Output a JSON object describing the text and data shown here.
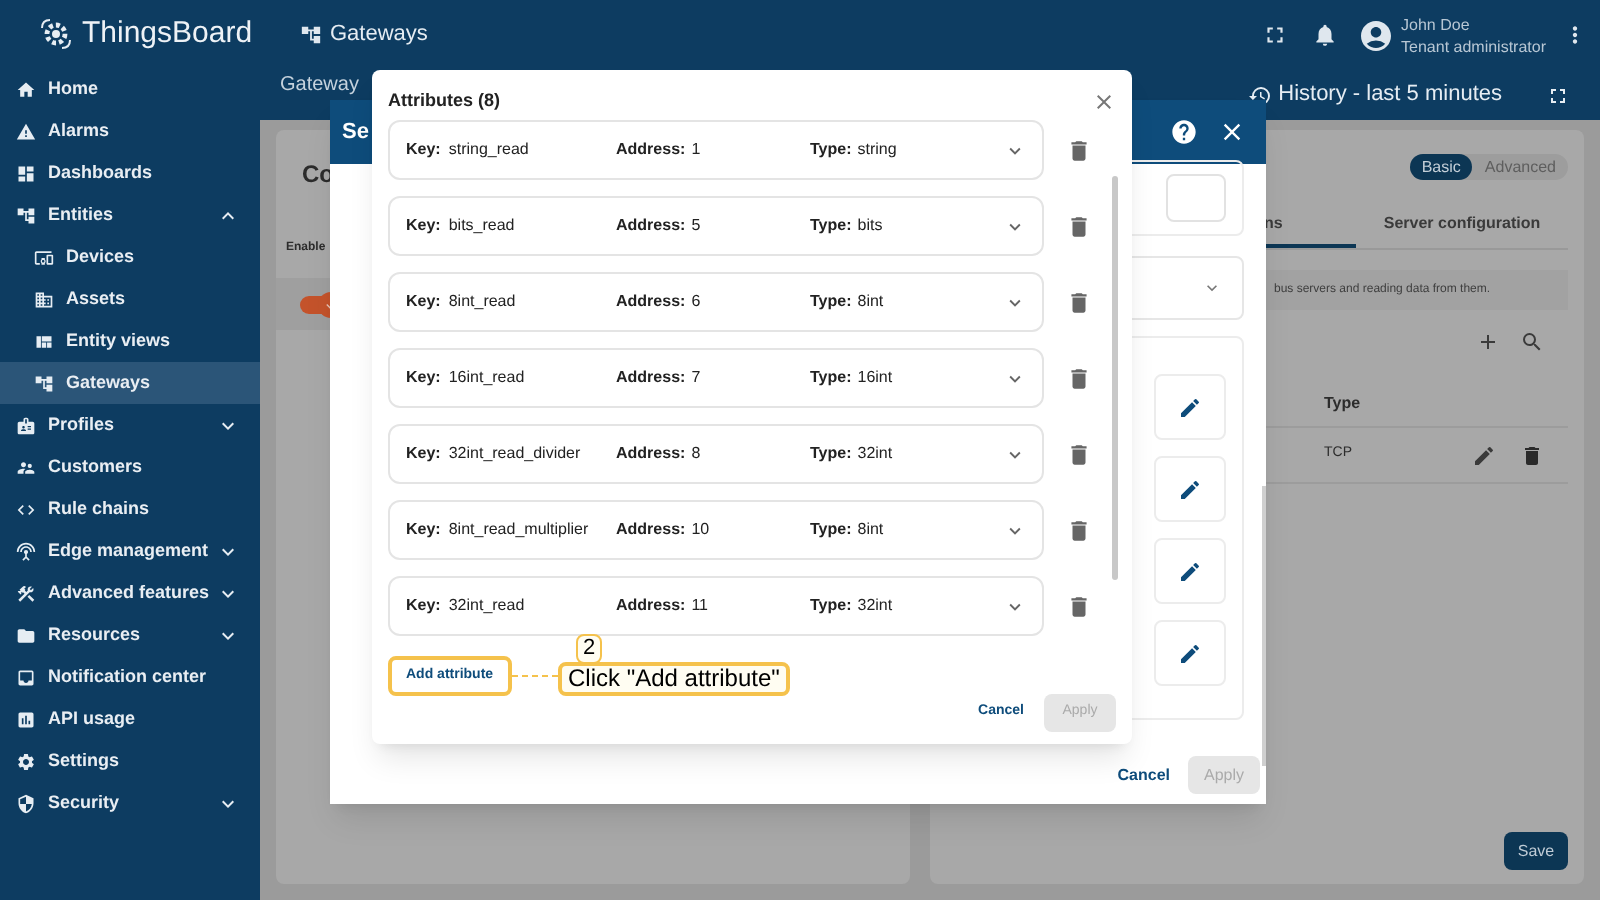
{
  "app": {
    "logo": "ThingsBoard"
  },
  "sidebar": {
    "items": [
      {
        "label": "Home",
        "kind": "link",
        "selected": false
      },
      {
        "label": "Alarms",
        "kind": "link",
        "selected": false
      },
      {
        "label": "Dashboards",
        "kind": "link",
        "selected": false
      },
      {
        "label": "Entities",
        "kind": "group",
        "selected": false,
        "expanded": true,
        "children": [
          {
            "label": "Devices",
            "selected": false
          },
          {
            "label": "Assets",
            "selected": false
          },
          {
            "label": "Entity views",
            "selected": false
          },
          {
            "label": "Gateways",
            "selected": true
          }
        ]
      },
      {
        "label": "Profiles",
        "kind": "group",
        "selected": false,
        "expanded": false
      },
      {
        "label": "Customers",
        "kind": "link",
        "selected": false
      },
      {
        "label": "Rule chains",
        "kind": "link",
        "selected": false
      },
      {
        "label": "Edge management",
        "kind": "group",
        "selected": false,
        "expanded": false
      },
      {
        "label": "Advanced features",
        "kind": "group",
        "selected": false,
        "expanded": false
      },
      {
        "label": "Resources",
        "kind": "group",
        "selected": false,
        "expanded": false
      },
      {
        "label": "Notification center",
        "kind": "link",
        "selected": false
      },
      {
        "label": "API usage",
        "kind": "link",
        "selected": false
      },
      {
        "label": "Settings",
        "kind": "link",
        "selected": false
      },
      {
        "label": "Security",
        "kind": "group",
        "selected": false,
        "expanded": false
      }
    ]
  },
  "header": {
    "breadcrumb": "Gateways",
    "user_name": "John Doe",
    "user_role": "Tenant administrator"
  },
  "subheader": {
    "title": "Gateway",
    "history": "History - last 5 minutes"
  },
  "left_card": {
    "title": "Co",
    "label": "Enable",
    "toggle_on": true
  },
  "right_card": {
    "modes": [
      {
        "label": "Basic",
        "selected": true
      },
      {
        "label": "Advanced",
        "selected": false
      }
    ],
    "tabs": [
      {
        "label": "ns",
        "selected": true
      },
      {
        "label": "Server configuration",
        "selected": false
      }
    ],
    "info": "bus servers and reading data from them.",
    "table": {
      "columns": [
        "Type"
      ],
      "rows": [
        [
          "TCP"
        ]
      ]
    },
    "save": "Save"
  },
  "outer_dialog": {
    "title": "Se",
    "cancel": "Cancel",
    "apply": {
      "label": "Apply",
      "disabled": true
    }
  },
  "attributes_dialog": {
    "title": "Attributes (8)",
    "attributes": [
      {
        "key_label": "Key:",
        "key": "string_read",
        "address_label": "Address:",
        "address": "1",
        "type_label": "Type:",
        "type": "string"
      },
      {
        "key_label": "Key:",
        "key": "bits_read",
        "address_label": "Address:",
        "address": "5",
        "type_label": "Type:",
        "type": "bits"
      },
      {
        "key_label": "Key:",
        "key": "8int_read",
        "address_label": "Address:",
        "address": "6",
        "type_label": "Type:",
        "type": "8int"
      },
      {
        "key_label": "Key:",
        "key": "16int_read",
        "address_label": "Address:",
        "address": "7",
        "type_label": "Type:",
        "type": "16int"
      },
      {
        "key_label": "Key:",
        "key": "32int_read_divider",
        "address_label": "Address:",
        "address": "8",
        "type_label": "Type:",
        "type": "32int"
      },
      {
        "key_label": "Key:",
        "key": "8int_read_multiplier",
        "address_label": "Address:",
        "address": "10",
        "type_label": "Type:",
        "type": "8int"
      },
      {
        "key_label": "Key:",
        "key": "32int_read",
        "address_label": "Address:",
        "address": "11",
        "type_label": "Type:",
        "type": "32int"
      }
    ],
    "add_button": "Add attribute",
    "cancel": "Cancel",
    "apply": {
      "label": "Apply",
      "disabled": true
    }
  },
  "annotation": {
    "step": "2",
    "text": "Click \"Add attribute\""
  }
}
